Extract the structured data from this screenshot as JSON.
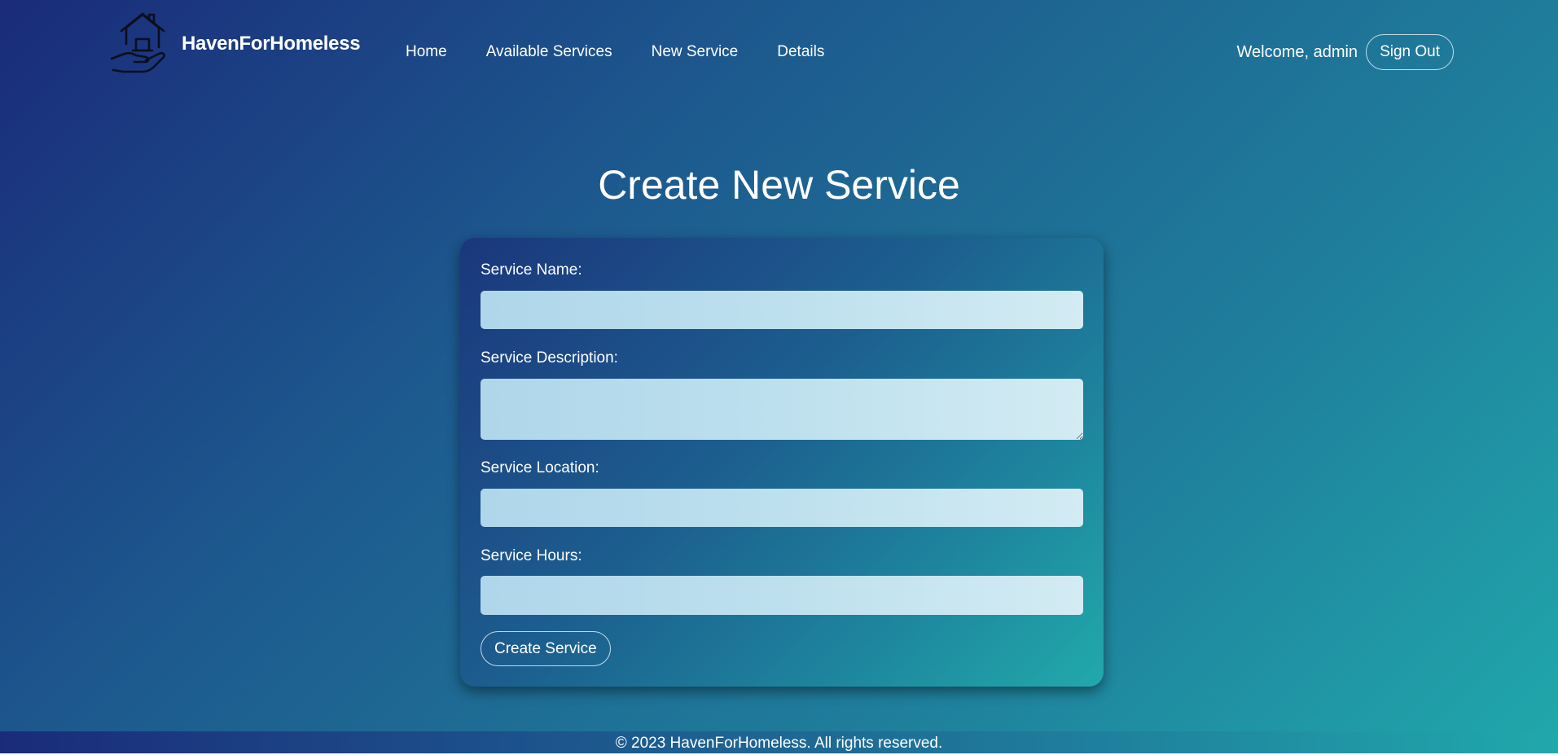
{
  "header": {
    "brand_name": "HavenForHomeless",
    "logo_icon": "house-in-hand-icon",
    "nav": [
      {
        "label": "Home"
      },
      {
        "label": "Available Services"
      },
      {
        "label": "New Service"
      },
      {
        "label": "Details"
      }
    ],
    "welcome_text": "Welcome, admin",
    "signout_label": "Sign Out"
  },
  "main": {
    "title": "Create New Service",
    "form": {
      "name_label": "Service Name:",
      "name_value": "",
      "description_label": "Service Description:",
      "description_value": "",
      "location_label": "Service Location:",
      "location_value": "",
      "hours_label": "Service Hours:",
      "hours_value": "",
      "submit_label": "Create Service"
    }
  },
  "footer": {
    "text": "© 2023 HavenForHomeless. All rights reserved."
  },
  "colors": {
    "gradient_start": "#1a2b7a",
    "gradient_end": "#20a8ac",
    "input_bg": "#bde0ee",
    "text": "#ffffff"
  }
}
